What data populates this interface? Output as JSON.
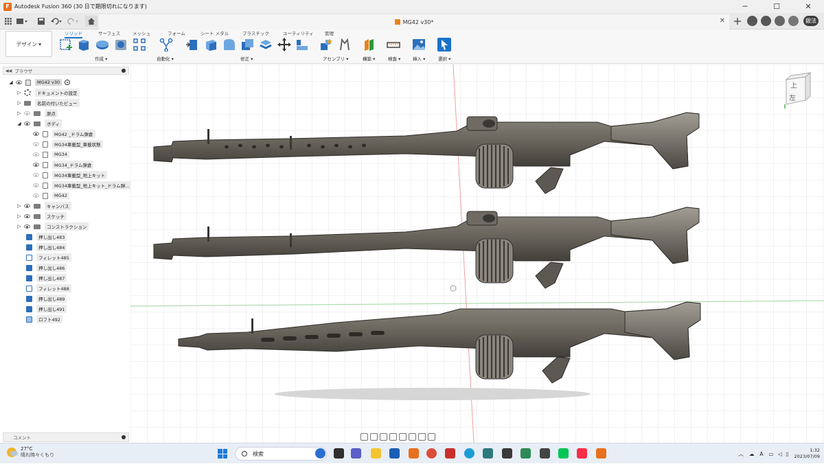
{
  "titlebar": {
    "title": "Autodesk Fusion 360 (30 日で期限切れになります)",
    "minimize": "─",
    "maximize": "☐",
    "close": "✕"
  },
  "document_tab": {
    "title": "MG42 v30*",
    "close": "✕",
    "user_badge": "銀法"
  },
  "toolbar": {
    "workspace": "デザイン ▾",
    "tabs": [
      "ソリッド",
      "サーフェス",
      "メッシュ",
      "フォーム",
      "シート メタル",
      "プラスチック",
      "ユーティリティ",
      "管理"
    ],
    "groups": [
      "作成 ▾",
      "自動化 ▾",
      "修正 ▾",
      "アセンブリ ▾",
      "構築 ▾",
      "検査 ▾",
      "挿入 ▾",
      "選択 ▾"
    ]
  },
  "browser": {
    "header": "ブラウザ",
    "root": "MG42 v30",
    "items": [
      {
        "label": "ドキュメントの設定"
      },
      {
        "label": "名前の付いたビュー"
      },
      {
        "label": "原点"
      },
      {
        "label": "ボディ"
      },
      {
        "label": "MG42 _ドラム弾倉"
      },
      {
        "label": "MG34車載型_車載状態"
      },
      {
        "label": "MG34"
      },
      {
        "label": "MG34_ドラム弾倉"
      },
      {
        "label": "MG34車載型_地上キット"
      },
      {
        "label": "MG34車載型_地上キット_ドラム弾..."
      },
      {
        "label": "MG42"
      },
      {
        "label": "キャンバス"
      },
      {
        "label": "スケッチ"
      },
      {
        "label": "コンストラクション"
      }
    ],
    "features": [
      "押し出し483",
      "押し出し484",
      "フィレット485",
      "押し出し486",
      "押し出し487",
      "フィレット488",
      "押し出し489",
      "押し出し491",
      "ロフト492"
    ]
  },
  "viewcube": {
    "top_label": "上",
    "left_label": "左"
  },
  "comment": {
    "label": "コメント"
  },
  "taskbar": {
    "temperature": "27°C",
    "weather": "晴れ時々くもり",
    "search_placeholder": "検索",
    "ime": "A",
    "time": "1:32",
    "date": "2023/07/09"
  },
  "colors": {
    "accent": "#1a72c9",
    "fusion_orange": "#e8701e",
    "gun_metal": "#6a655c"
  }
}
